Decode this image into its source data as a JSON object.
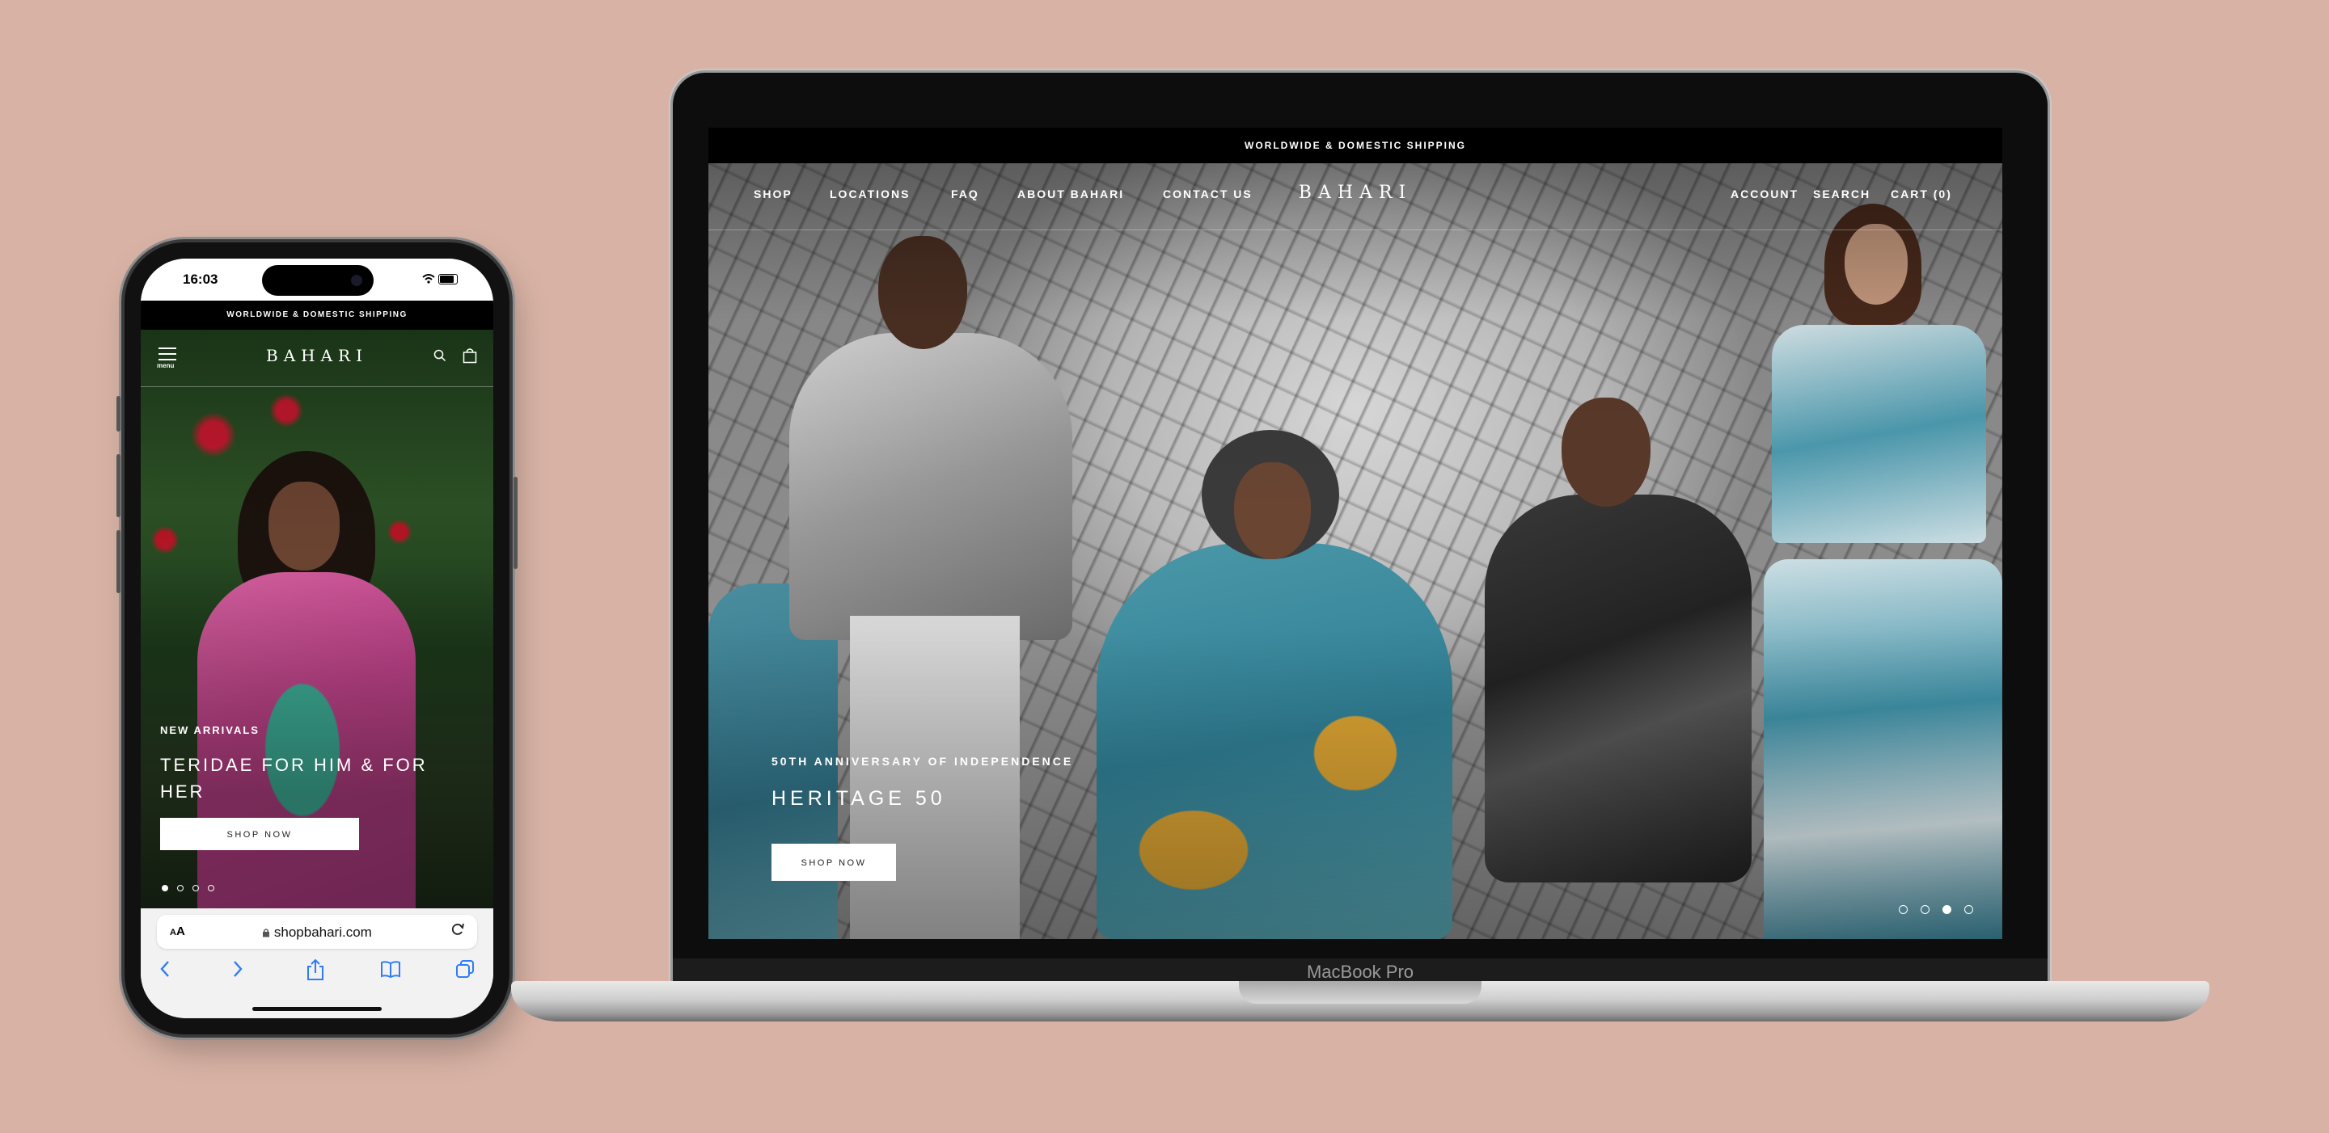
{
  "phone": {
    "status_time": "16:03",
    "announcement": "WORLDWIDE & DOMESTIC SHIPPING",
    "menu_label": "menu",
    "logo": "BAHARI",
    "eyebrow": "NEW ARRIVALS",
    "heading": "TERIDAE FOR HIM & FOR HER",
    "shop_button": "SHOP NOW",
    "slide_count": 4,
    "active_slide": 1,
    "browser": {
      "text_size_label": "AA",
      "url": "shopbahari.com",
      "toolbar_icons": [
        "back-icon",
        "forward-icon",
        "share-icon",
        "bookmarks-icon",
        "tabs-icon"
      ]
    }
  },
  "laptop": {
    "announcement": "WORLDWIDE & DOMESTIC SHIPPING",
    "nav_left": [
      "SHOP",
      "LOCATIONS",
      "FAQ",
      "ABOUT BAHARI",
      "CONTACT US"
    ],
    "logo": "BAHARI",
    "nav_right": [
      "ACCOUNT",
      "SEARCH",
      "CART (0)"
    ],
    "eyebrow": "50TH ANNIVERSARY OF INDEPENDENCE",
    "heading": "HERITAGE 50",
    "shop_button": "SHOP NOW",
    "slide_count": 4,
    "active_slide": 3,
    "device_label": "MacBook Pro"
  },
  "colors": {
    "background": "#d8b3a5",
    "announcement_bar": "#000000",
    "browser_accent": "#2f7cf6"
  }
}
